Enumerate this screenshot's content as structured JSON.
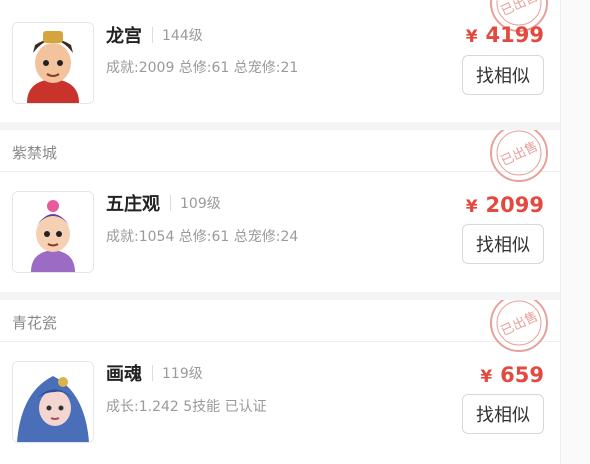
{
  "listings": [
    {
      "server": "",
      "name": "龙宫",
      "level": "144级",
      "stats": "成就:2009 总修:61 总宠修:21",
      "currency": "¥",
      "price": "4199",
      "button": "找相似",
      "stamp": "已出售",
      "avatar_icon": "longgong-character-avatar"
    },
    {
      "server": "紫禁城",
      "name": "五庄观",
      "level": "109级",
      "stats": "成就:1054 总修:61 总宠修:24",
      "currency": "¥",
      "price": "2099",
      "button": "找相似",
      "stamp": "已出售",
      "avatar_icon": "wuzhuangguan-character-avatar"
    },
    {
      "server": "青花瓷",
      "name": "画魂",
      "level": "119级",
      "stats": "成长:1.242 5技能 已认证",
      "currency": "¥",
      "price": "659",
      "button": "找相似",
      "stamp": "已出售",
      "avatar_icon": "huahun-pet-avatar"
    }
  ],
  "colors": {
    "price": "#e34a3f",
    "stamp": "#e8a09a"
  }
}
